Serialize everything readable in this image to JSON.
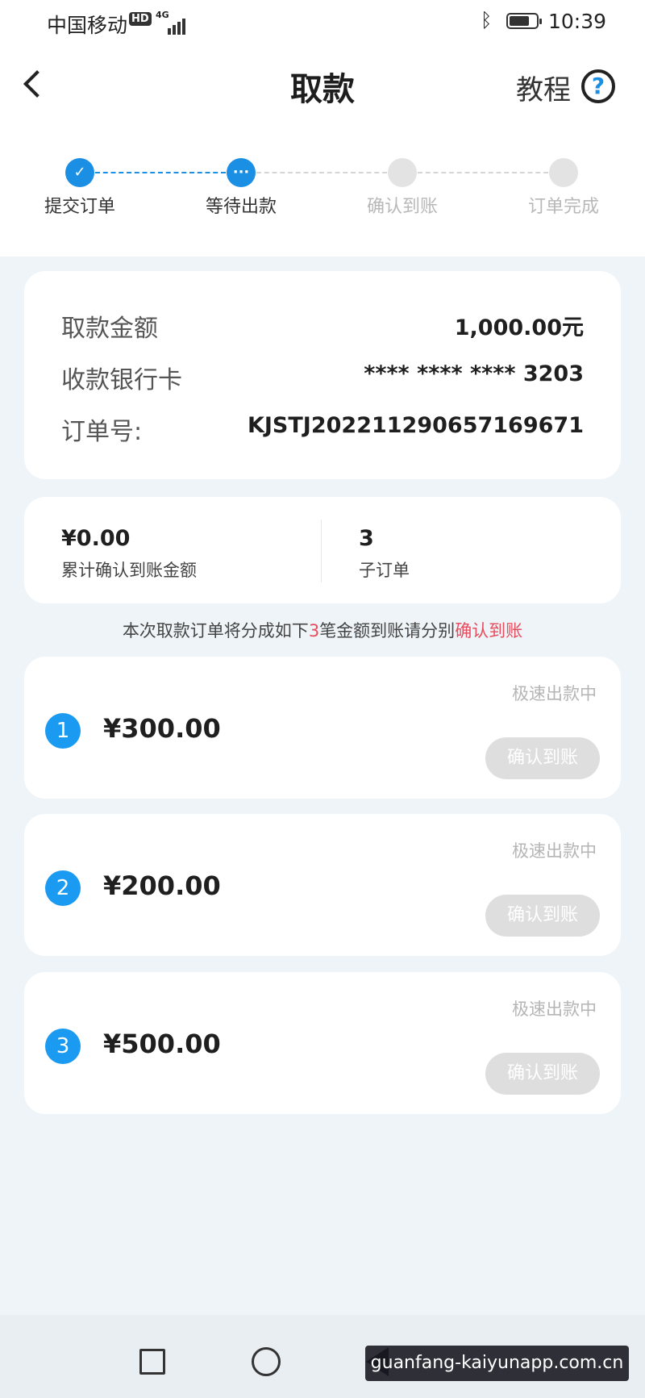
{
  "status_bar": {
    "carrier": "中国移动",
    "hd_badge": "HD",
    "network": "4G",
    "time": "10:39"
  },
  "header": {
    "title": "取款",
    "tutorial_label": "教程",
    "help_icon": "?"
  },
  "steps": [
    {
      "label": "提交订单",
      "state": "done"
    },
    {
      "label": "等待出款",
      "state": "current"
    },
    {
      "label": "确认到账",
      "state": "pending"
    },
    {
      "label": "订单完成",
      "state": "pending"
    }
  ],
  "withdraw_info": {
    "amount_label": "取款金额",
    "amount_value": "1,000.00元",
    "card_label": "收款银行卡",
    "card_value": "**** **** **** 3203",
    "order_label": "订单号:",
    "order_value": "KJSTJ202211290657169671"
  },
  "summary": {
    "confirmed_amount": "¥0.00",
    "confirmed_label": "累计确认到账金额",
    "sub_order_count": "3",
    "sub_order_label": "子订单"
  },
  "notice": {
    "prefix": "本次取款订单将分成如下",
    "count": "3",
    "middle": "笔金额到账请分别",
    "action": "确认到账"
  },
  "sub_orders": [
    {
      "index": "1",
      "amount": "¥300.00",
      "state": "极速出款中",
      "button": "确认到账"
    },
    {
      "index": "2",
      "amount": "¥200.00",
      "state": "极速出款中",
      "button": "确认到账"
    },
    {
      "index": "3",
      "amount": "¥500.00",
      "state": "极速出款中",
      "button": "确认到账"
    }
  ],
  "watermark": "guanfang-kaiyunapp.com.cn",
  "colors": {
    "accent": "#1a8fe3",
    "highlight": "#e74d5e",
    "background": "#eef4f7"
  }
}
